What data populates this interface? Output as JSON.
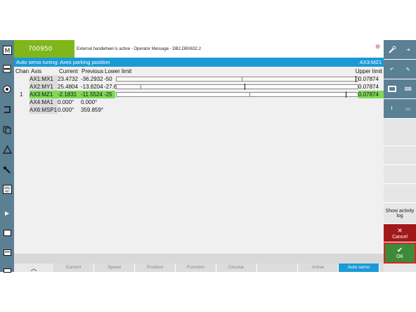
{
  "alarm": {
    "number": "700950"
  },
  "message": {
    "text": "External handwheel is active - Operator Message - DB2.DBX632.2"
  },
  "title": {
    "left": "Auto servo tuning: Axes parking position",
    "right": "AX3:MZ1"
  },
  "table": {
    "headers": {
      "chan": "Chan",
      "axis": "Axis",
      "current": "Current",
      "previous": "Previous",
      "lower": "Lower limit",
      "upper": "Upper limit"
    },
    "rows": [
      {
        "chan": "",
        "axis": "AX1:MX1",
        "current": "23.4732",
        "previous": "-36.2932",
        "lower": "-50",
        "upper": "0.07874",
        "has_slider": true,
        "ticks": [
          0.52,
          0.99
        ],
        "highlight": false
      },
      {
        "chan": "",
        "axis": "AX2:MY1",
        "current": "25.4804",
        "previous": "-13.8204",
        "lower": "-27.638",
        "upper": "0.07874",
        "has_slider": true,
        "ticks": [
          0.1,
          0.53
        ],
        "highlight": false
      },
      {
        "chan": "1",
        "axis": "AX3:MZ1",
        "current": "-2.1831",
        "previous": "-11.5524",
        "lower": "-25",
        "upper": "0.07874",
        "has_slider": true,
        "ticks": [
          0.55,
          0.95
        ],
        "highlight": true
      },
      {
        "chan": "",
        "axis": "AX4:MA1",
        "current": "0.000°",
        "previous": "0.000°",
        "lower": "",
        "upper": "",
        "has_slider": false,
        "highlight": false
      },
      {
        "chan": "",
        "axis": "AX6:MSP1",
        "current": "0.000°",
        "previous": "359.859°",
        "lower": "",
        "upper": "",
        "has_slider": false,
        "highlight": false
      }
    ]
  },
  "right_softkeys": {
    "show_activity_log": "Show activity log",
    "cancel": "Cancel",
    "ok": "OK"
  },
  "bottom_tabs": [
    {
      "label": "",
      "active": false
    },
    {
      "label": "Current",
      "active": false
    },
    {
      "label": "Speed",
      "active": false
    },
    {
      "label": "Position",
      "active": false
    },
    {
      "label": "Function",
      "active": false
    },
    {
      "label": "Circular.",
      "active": false
    },
    {
      "label": "",
      "active": false
    },
    {
      "label": "Active",
      "active": false
    },
    {
      "label": "Auto servo",
      "active": true
    }
  ],
  "colors": {
    "title_blue": "#1c9ad6",
    "alarm_green": "#7fb71a",
    "highlight_green": "#7ed957",
    "cancel_red": "#a3181a",
    "ok_green": "#3e8a3a"
  },
  "icons": {
    "left": [
      "machine-icon",
      "program-icon",
      "offset-icon",
      "program-manager-icon",
      "copy-icon",
      "diagnostics-icon",
      "setup-icon",
      "sinumerik-icon"
    ],
    "right_top": [
      "wrench-icon",
      "jog-icon",
      "undo-icon",
      "pen-icon",
      "monitor-icon",
      "keyboard-icon",
      "info-icon",
      "screen-icon"
    ]
  }
}
